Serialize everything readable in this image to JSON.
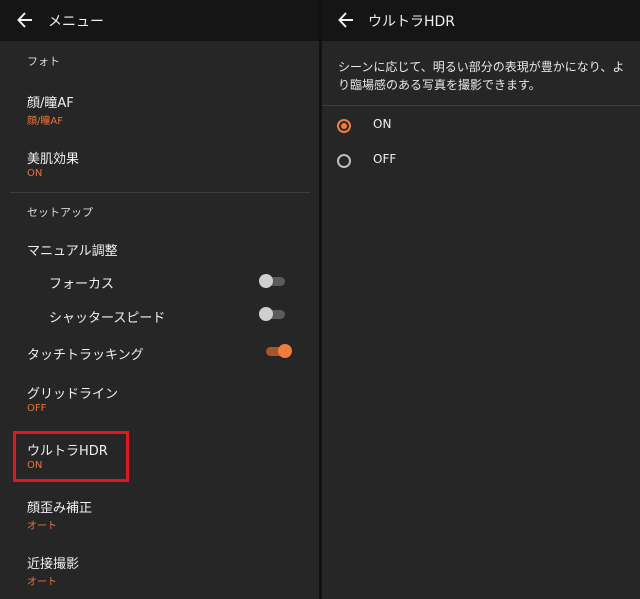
{
  "left": {
    "title": "メニュー",
    "sections": {
      "photo": "フォト",
      "setup": "セットアップ"
    },
    "items": {
      "face_af": {
        "title": "顔/瞳AF",
        "value": "顔/瞳AF"
      },
      "skin": {
        "title": "美肌効果",
        "value": "ON"
      },
      "manual": {
        "title": "マニュアル調整"
      },
      "focus": {
        "title": "フォーカス",
        "on": false
      },
      "shutter": {
        "title": "シャッタースピード",
        "on": false
      },
      "touch": {
        "title": "タッチトラッキング",
        "on": true
      },
      "grid": {
        "title": "グリッドライン",
        "value": "OFF"
      },
      "hdr": {
        "title": "ウルトラHDR",
        "value": "ON"
      },
      "distortion": {
        "title": "顔歪み補正",
        "value": "オート"
      },
      "macro": {
        "title": "近接撮影",
        "value": "オート"
      }
    }
  },
  "right": {
    "title": "ウルトラHDR",
    "description": "シーンに応じて、明るい部分の表現が豊かになり、より臨場感のある写真を撮影できます。",
    "options": [
      {
        "label": "ON",
        "selected": true
      },
      {
        "label": "OFF",
        "selected": false
      }
    ]
  },
  "colors": {
    "accent": "#f07c3e",
    "highlight": "#e5141d"
  }
}
